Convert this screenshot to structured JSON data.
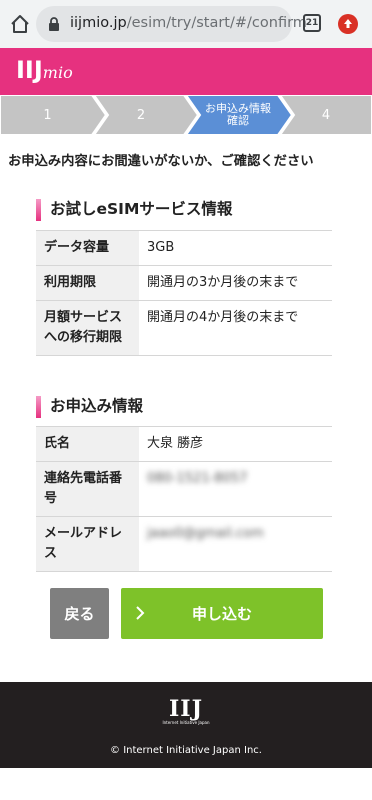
{
  "browser": {
    "url_host": "iijmio.jp",
    "url_path": "/esim/try/start/#/confirm",
    "tab_count": "21",
    "icons": {
      "home": "home-icon",
      "lock": "lock-icon",
      "tabs": "tabs-icon",
      "upload": "upload-icon"
    }
  },
  "header": {
    "logo_main": "IIJ",
    "logo_sub": "mio",
    "color": "#e6317f"
  },
  "steps": [
    {
      "label": "1"
    },
    {
      "label": "2"
    },
    {
      "label_line1": "お申込み情報",
      "label_line2": "確認",
      "active": true
    },
    {
      "label": "4"
    }
  ],
  "lead": "お申込み内容にお間違いがないか、ご確認ください",
  "sections": [
    {
      "title": "お試しeSIMサービス情報",
      "rows": [
        {
          "label": "データ容量",
          "value": "3GB"
        },
        {
          "label": "利用期限",
          "value": "開通月の3か月後の末まで"
        },
        {
          "label": "月額サービスへの移行期限",
          "value": "開通月の4か月後の末まで"
        }
      ]
    },
    {
      "title": "お申込み情報",
      "rows": [
        {
          "label": "氏名",
          "value": "大泉 勝彦"
        },
        {
          "label": "連絡先電話番号",
          "value": "080-1521-8057"
        },
        {
          "label": "メールアドレス",
          "value": "jaao0@gmail.com"
        }
      ]
    }
  ],
  "buttons": {
    "back": "戻る",
    "apply": "申し込む"
  },
  "footer": {
    "logo": "IIJ",
    "logo_sub": "Internet Initiative Japan",
    "copyright": "© Internet Initiative Japan Inc."
  },
  "colors": {
    "step_inactive": "#c4c4c4",
    "step_active": "#5b8fd6",
    "apply": "#7ec229",
    "back": "#7f7f7f",
    "footer_bg": "#231f20"
  }
}
